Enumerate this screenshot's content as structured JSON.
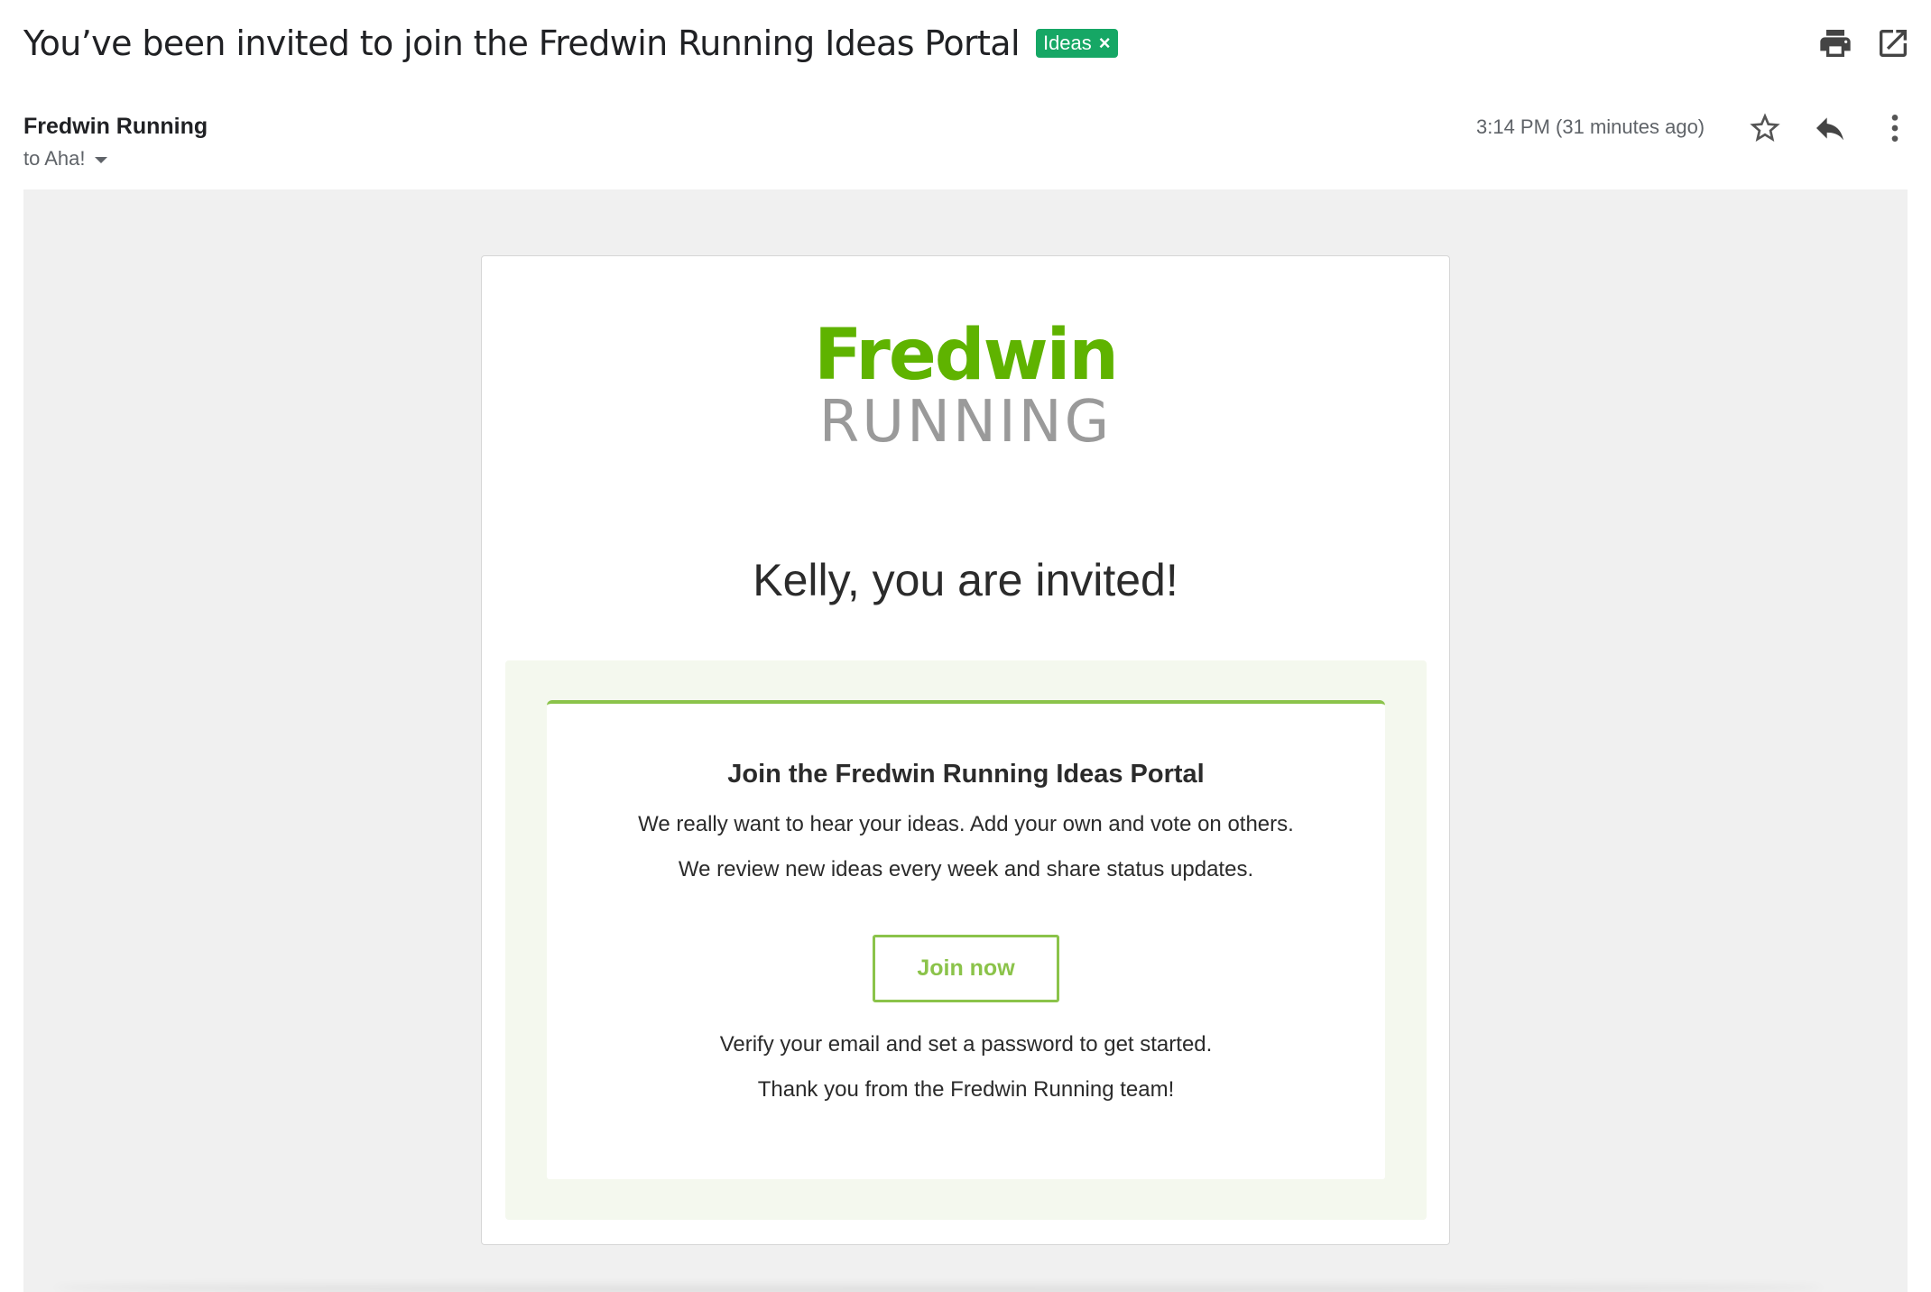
{
  "email": {
    "subject": "You’ve been invited to join the Fredwin Running Ideas Portal",
    "label": "Ideas",
    "label_color": "#16a765",
    "sender_name": "Fredwin Running",
    "recipient": "to Aha!",
    "timestamp": "3:14 PM (31 minutes ago)"
  },
  "toolbar": {
    "icons": [
      "print-icon",
      "open-in-new-window-icon",
      "star-icon",
      "reply-icon",
      "more-options-icon"
    ]
  },
  "body": {
    "logo": {
      "brand_top": "Fredwin",
      "brand_bottom": "RUNNING",
      "brand_color": "#5fb300"
    },
    "headline": "Kelly, you are invited!",
    "cta": {
      "title": "Join the Fredwin Running Ideas Portal",
      "line1": "We really want to hear your ideas. Add your own and vote on others.",
      "line2": "We review new ideas every week and share status updates.",
      "button_label": "Join now",
      "line3": "Verify your email and set a password to get started.",
      "line4": "Thank you from the Fredwin Running team!",
      "accent_color": "#8bc34a"
    }
  }
}
